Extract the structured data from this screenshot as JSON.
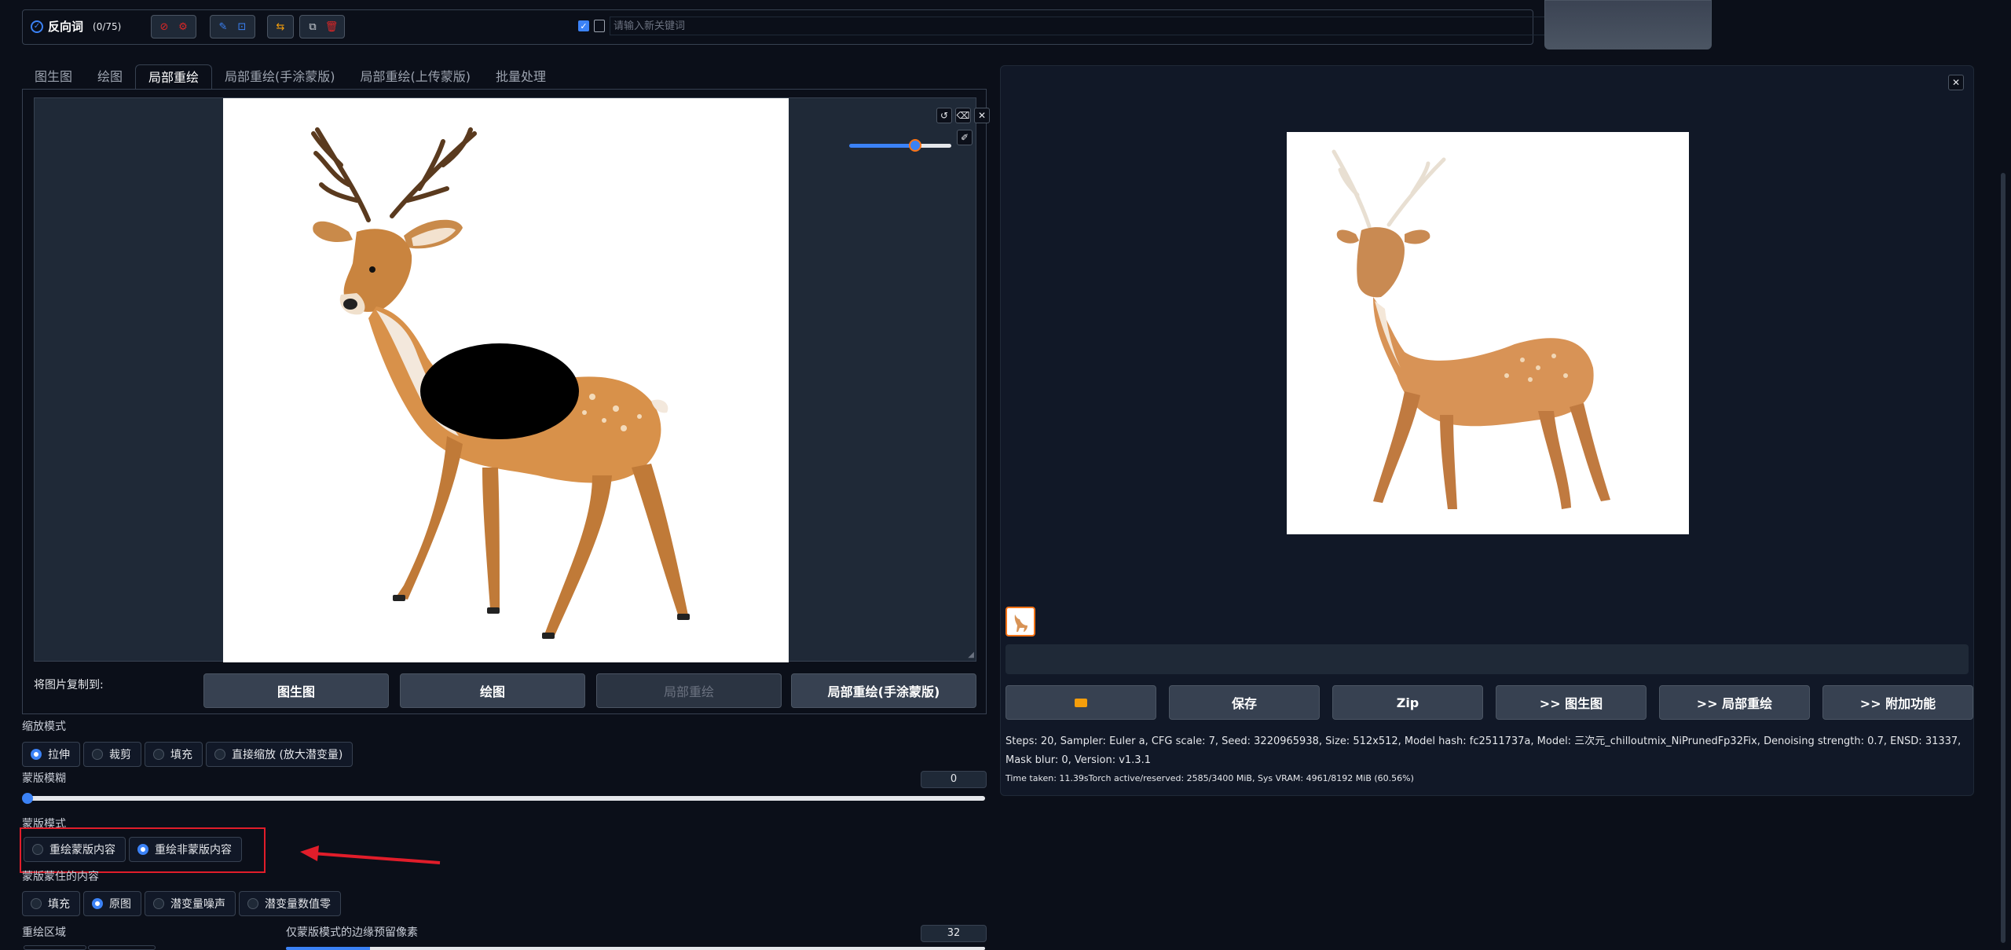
{
  "negative_prompt": {
    "label": "反向词",
    "count": "(0/75)",
    "keyword_placeholder": "请输入新关键词"
  },
  "tabs": [
    "图生图",
    "绘图",
    "局部重绘",
    "局部重绘(手涂蒙版)",
    "局部重绘(上传蒙版)",
    "批量处理"
  ],
  "copy_to": {
    "label": "将图片复制到:",
    "buttons": [
      "图生图",
      "绘图",
      "局部重绘",
      "局部重绘(手涂蒙版)"
    ]
  },
  "resize_mode": {
    "label": "缩放模式",
    "options": [
      "拉伸",
      "裁剪",
      "填充",
      "直接缩放 (放大潜变量)"
    ],
    "selected": "拉伸"
  },
  "mask_blur": {
    "label": "蒙版模糊",
    "value": "0"
  },
  "mask_mode": {
    "label": "蒙版模式",
    "options": [
      "重绘蒙版内容",
      "重绘非蒙版内容"
    ],
    "selected": "重绘非蒙版内容"
  },
  "masked_content": {
    "label": "蒙版蒙住的内容",
    "options": [
      "填充",
      "原图",
      "潜变量噪声",
      "潜变量数值零"
    ],
    "selected": "原图"
  },
  "inpaint_area": {
    "label": "重绘区域"
  },
  "only_masked_padding": {
    "label": "仅蒙版模式的边缘预留像素",
    "value": "32"
  },
  "output": {
    "buttons": [
      "",
      "保存",
      "Zip",
      ">> 图生图",
      ">> 局部重绘",
      ">> 附加功能"
    ],
    "info": "Steps: 20, Sampler: Euler a, CFG scale: 7, Seed: 3220965938, Size: 512x512, Model hash: fc2511737a, Model: 三次元_chilloutmix_NiPrunedFp32Fix, Denoising strength: 0.7, ENSD: 31337, Mask blur: 0, Version: v1.3.1",
    "timing": "Time taken: 11.39sTorch active/reserved: 2585/3400 MiB, Sys VRAM: 4961/8192 MiB (60.56%)"
  },
  "slider_levels": {
    "brush_size": 0.63,
    "mask_blur": 0.0,
    "padding": 0.12
  },
  "colors": {
    "accent": "#3b82f6",
    "highlight": "#e11d2a",
    "background": "#0b0f19"
  }
}
